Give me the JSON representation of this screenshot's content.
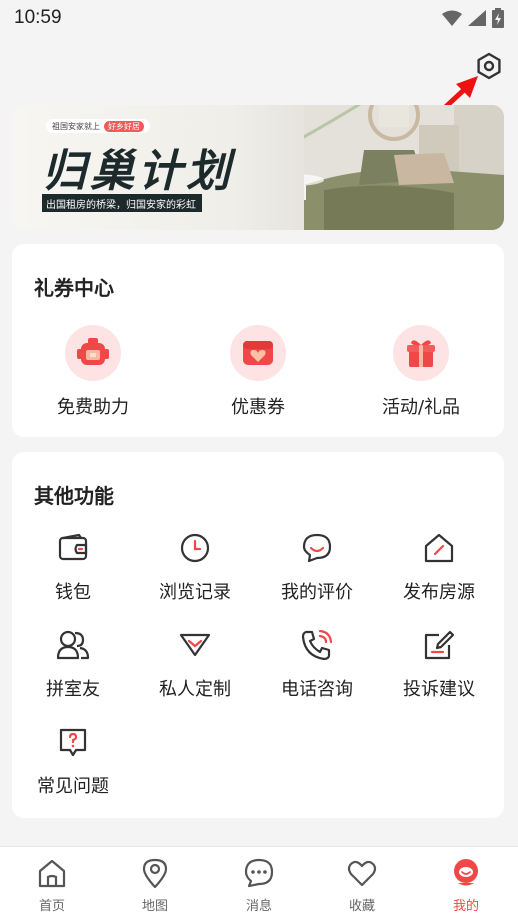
{
  "status": {
    "time": "10:59"
  },
  "banner": {
    "tag_text": "祖国安家就上",
    "tag_pill": "好乡好居",
    "title": "归巢计划",
    "subtitle": "出国租房的桥梁，归国安家的彩虹"
  },
  "coupon_center": {
    "title": "礼券中心",
    "items": [
      {
        "label": "免费助力",
        "icon": "robot-gift-icon"
      },
      {
        "label": "优惠券",
        "icon": "coupon-heart-icon"
      },
      {
        "label": "活动/礼品",
        "icon": "gift-box-icon"
      }
    ]
  },
  "other_functions": {
    "title": "其他功能",
    "items": [
      {
        "label": "钱包",
        "icon": "wallet-icon"
      },
      {
        "label": "浏览记录",
        "icon": "clock-icon"
      },
      {
        "label": "我的评价",
        "icon": "comment-smile-icon"
      },
      {
        "label": "发布房源",
        "icon": "house-edit-icon"
      },
      {
        "label": "拼室友",
        "icon": "roommates-icon"
      },
      {
        "label": "私人定制",
        "icon": "diamond-icon"
      },
      {
        "label": "电话咨询",
        "icon": "phone-icon"
      },
      {
        "label": "投诉建议",
        "icon": "edit-note-icon"
      },
      {
        "label": "常见问题",
        "icon": "faq-icon"
      }
    ]
  },
  "tabbar": {
    "items": [
      {
        "label": "首页",
        "icon": "home-icon"
      },
      {
        "label": "地图",
        "icon": "map-pin-icon"
      },
      {
        "label": "消息",
        "icon": "message-icon"
      },
      {
        "label": "收藏",
        "icon": "heart-icon"
      },
      {
        "label": "我的",
        "icon": "profile-mascot-icon"
      }
    ],
    "active_index": 4
  },
  "colors": {
    "accent": "#f04848",
    "pink_light": "#fde3e4",
    "icon_dark": "#333333"
  }
}
